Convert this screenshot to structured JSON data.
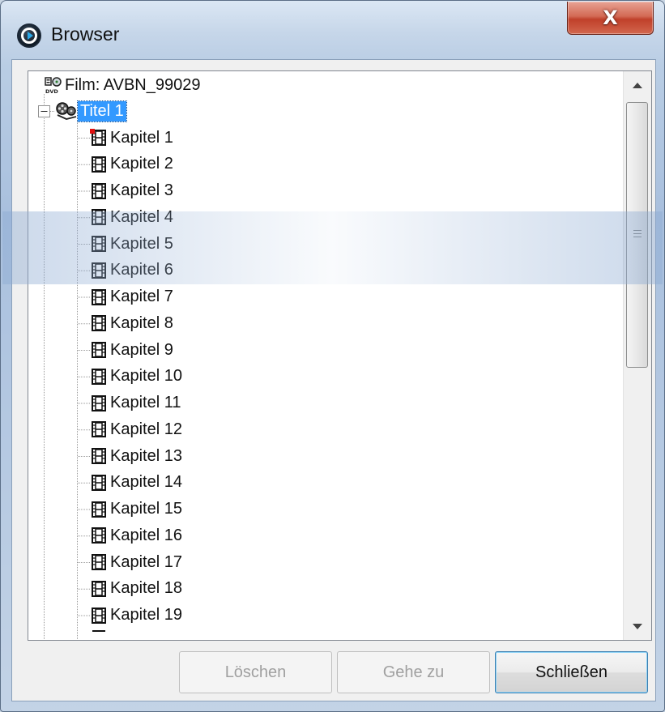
{
  "window": {
    "title": "Browser",
    "close_glyph": "X"
  },
  "tree": {
    "root": {
      "label": "Film: AVBN_99029",
      "icon": "dvd-icon"
    },
    "title_node": {
      "label": "Titel 1",
      "icon": "film-reel-icon",
      "expanded": true,
      "selected": true
    },
    "chapters": [
      "Kapitel 1",
      "Kapitel 2",
      "Kapitel 3",
      "Kapitel 4",
      "Kapitel 5",
      "Kapitel 6",
      "Kapitel 7",
      "Kapitel 8",
      "Kapitel 9",
      "Kapitel 10",
      "Kapitel 11",
      "Kapitel 12",
      "Kapitel 13",
      "Kapitel 14",
      "Kapitel 15",
      "Kapitel 16",
      "Kapitel 17",
      "Kapitel 18",
      "Kapitel 19"
    ],
    "chapter_icon": "film-strip-icon"
  },
  "buttons": {
    "delete_label": "Löschen",
    "goto_label": "Gehe zu",
    "close_label": "Schließen"
  },
  "colors": {
    "selection": "#3399ff",
    "close_button": "#c0402a",
    "marker": "#e01010"
  }
}
